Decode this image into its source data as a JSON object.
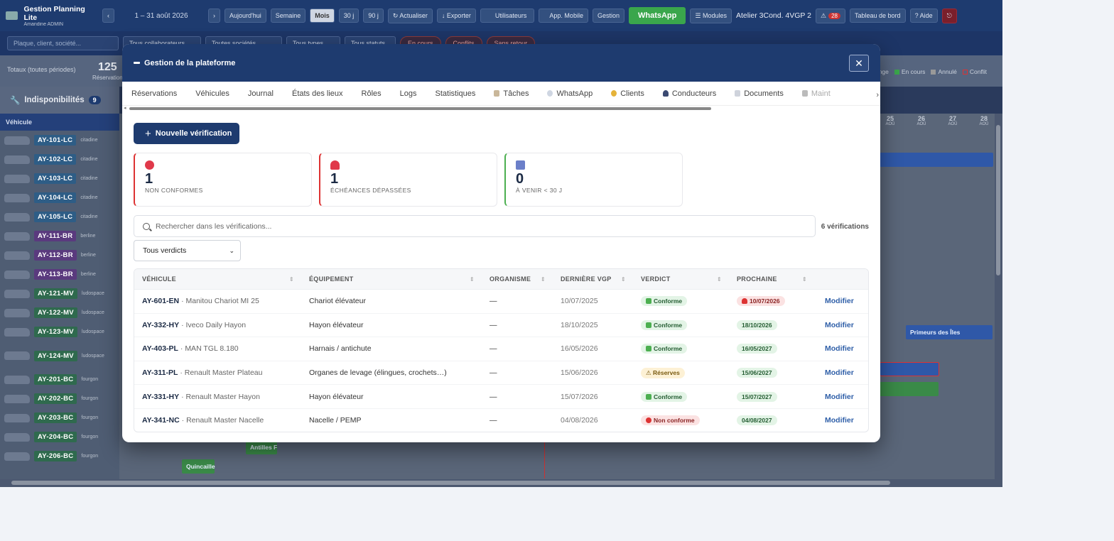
{
  "app": {
    "title": "Gestion Planning Lite",
    "user": "Amandine ADMIN",
    "period": "1 – 31 août 2026",
    "nav": {
      "prev": "‹",
      "next": "›",
      "today": "Aujourd'hui",
      "week": "Semaine",
      "month": "Mois",
      "d30": "30 j",
      "d90": "90 j"
    },
    "toolbar": {
      "refresh": "↻ Actualiser",
      "export": "↓ Exporter",
      "users": "Utilisateurs",
      "mobile": "App. Mobile",
      "gestion": "Gestion",
      "whatsapp": "WhatsApp",
      "modules": "☰ Modules",
      "atelier": "Atelier 3Cond. 4VGP 2",
      "alerts": "28",
      "dashboard": "Tableau de bord",
      "help": "? Aide",
      "power": "⎋"
    },
    "filters": {
      "search_placeholder": "Plaque, client, société...",
      "collab": "Tous collaborateurs",
      "societes": "Toutes sociétés",
      "types": "Tous types",
      "statuts": "Tous statuts",
      "encours": "En cours",
      "conflits": "Conflits",
      "sansretour": "Sans retour"
    },
    "totals": {
      "label": "Totaux (toutes périodes)",
      "count": "125",
      "count_label": "Réservations"
    },
    "legend": {
      "change": "hange",
      "encours": "En cours",
      "annule": "Annulé",
      "conflit": "Conflit"
    },
    "indispo": {
      "label": "Indisponibilités",
      "count": "9"
    },
    "vehicle_header": "Véhicule",
    "vehicles": [
      {
        "plate": "AY-101-LC",
        "type": "citadine",
        "color": "blue"
      },
      {
        "plate": "AY-102-LC",
        "type": "citadine",
        "color": "blue"
      },
      {
        "plate": "AY-103-LC",
        "type": "citadine",
        "color": "blue"
      },
      {
        "plate": "AY-104-LC",
        "type": "citadine",
        "color": "blue"
      },
      {
        "plate": "AY-105-LC",
        "type": "citadine",
        "color": "blue"
      },
      {
        "plate": "AY-111-BR",
        "type": "berline",
        "color": "purple"
      },
      {
        "plate": "AY-112-BR",
        "type": "berline",
        "color": "purple"
      },
      {
        "plate": "AY-113-BR",
        "type": "berline",
        "color": "purple"
      },
      {
        "plate": "AY-121-MV",
        "type": "ludospace",
        "color": "green"
      },
      {
        "plate": "AY-122-MV",
        "type": "ludospace",
        "color": "green"
      },
      {
        "plate": "AY-123-MV",
        "type": "ludospace",
        "color": "green"
      },
      {
        "plate": "AY-124-MV",
        "type": "ludospace",
        "color": "green"
      },
      {
        "plate": "AY-201-BC",
        "type": "fourgon",
        "color": "green"
      },
      {
        "plate": "AY-202-BC",
        "type": "fourgon",
        "color": "green"
      },
      {
        "plate": "AY-203-BC",
        "type": "fourgon",
        "color": "green"
      },
      {
        "plate": "AY-204-BC",
        "type": "fourgon",
        "color": "green"
      },
      {
        "plate": "AY-206-BC",
        "type": "fourgon",
        "color": "green"
      }
    ],
    "days": [
      {
        "n": "25",
        "d": "AOÛ"
      },
      {
        "n": "26",
        "d": "AOÛ"
      },
      {
        "n": "27",
        "d": "AOÛ"
      },
      {
        "n": "28",
        "d": "AOÛ"
      }
    ],
    "bars": {
      "primeurs": "Primeurs des Îles",
      "antilles": "Antilles F",
      "quincaille": "Quincaille"
    }
  },
  "modal": {
    "title": "Gestion de la plateforme",
    "close": "✕",
    "tabs": [
      "Réservations",
      "Véhicules",
      "Journal",
      "États des lieux",
      "Rôles",
      "Logs",
      "Statistiques",
      "Tâches",
      "WhatsApp",
      "Clients",
      "Conducteurs",
      "Documents",
      "Maint"
    ],
    "new_button": "Nouvelle vérification",
    "cards": [
      {
        "value": "1",
        "label": "NON CONFORMES"
      },
      {
        "value": "1",
        "label": "ÉCHÉANCES DÉPASSÉES"
      },
      {
        "value": "0",
        "label": "À VENIR < 30 J"
      }
    ],
    "search_placeholder": "Rechercher dans les vérifications...",
    "count": "6 vérifications",
    "verdict_filter": "Tous verdicts",
    "columns": [
      "VÉHICULE",
      "ÉQUIPEMENT",
      "ORGANISME",
      "DERNIÈRE VGP",
      "VERDICT",
      "PROCHAINE"
    ],
    "rows": [
      {
        "plate": "AY-601-EN",
        "model": " · Manitou Chariot MI 25",
        "equip": "Chariot élévateur",
        "org": "—",
        "last": "10/07/2025",
        "verdict": "Conforme",
        "next": "10/07/2026",
        "action": "Modifier"
      },
      {
        "plate": "AY-332-HY",
        "model": " · Iveco Daily Hayon",
        "equip": "Hayon élévateur",
        "org": "—",
        "last": "18/10/2025",
        "verdict": "Conforme",
        "next": "18/10/2026",
        "action": "Modifier"
      },
      {
        "plate": "AY-403-PL",
        "model": " · MAN TGL 8.180",
        "equip": "Harnais / antichute",
        "org": "—",
        "last": "16/05/2026",
        "verdict": "Conforme",
        "next": "16/05/2027",
        "action": "Modifier"
      },
      {
        "plate": "AY-311-PL",
        "model": " · Renault Master Plateau",
        "equip": "Organes de levage (élingues, crochets…)",
        "org": "—",
        "last": "15/06/2026",
        "verdict": "⚠ Réserves",
        "next": "15/06/2027",
        "action": "Modifier"
      },
      {
        "plate": "AY-331-HY",
        "model": " · Renault Master Hayon",
        "equip": "Hayon élévateur",
        "org": "—",
        "last": "15/07/2026",
        "verdict": "Conforme",
        "next": "15/07/2027",
        "action": "Modifier"
      },
      {
        "plate": "AY-341-NC",
        "model": " · Renault Master Nacelle",
        "equip": "Nacelle / PEMP",
        "org": "—",
        "last": "04/08/2026",
        "verdict": "Non conforme",
        "next": "04/08/2027",
        "action": "Modifier"
      }
    ]
  },
  "colors": {
    "primary": "#1e3b6f",
    "whatsapp": "#3aa64c",
    "danger": "#d33",
    "success": "#4caf50"
  }
}
